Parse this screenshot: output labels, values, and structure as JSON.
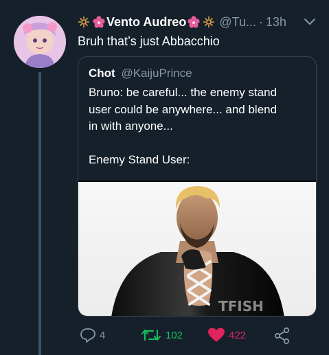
{
  "tweet": {
    "display_name": "Vento Audreo",
    "handle": "@Tu...",
    "time": "13h",
    "separator": "·",
    "text": "Bruh that’s just Abbacchio"
  },
  "quote": {
    "name": "Chot",
    "handle": "@KaijuPrince",
    "lines": [
      "Bruno: be careful... the enemy stand",
      "user could be anywhere... and blend",
      "in with anyone...",
      "",
      "Enemy Stand User:"
    ],
    "image_watermark": "TFISH"
  },
  "actions": {
    "reply_count": "4",
    "retweet_count": "102",
    "like_count": "422"
  },
  "colors": {
    "background": "#15202b",
    "secondary_text": "#8899a6",
    "retweet_green": "#17bf63",
    "like_pink": "#e0245e",
    "thread_line": "#3d5466",
    "name_flower": "#e75c9a"
  },
  "icons": {
    "reply": "reply-icon",
    "retweet": "retweet-icon",
    "like": "heart-icon",
    "share": "share-icon",
    "more": "chevron-down-icon"
  }
}
